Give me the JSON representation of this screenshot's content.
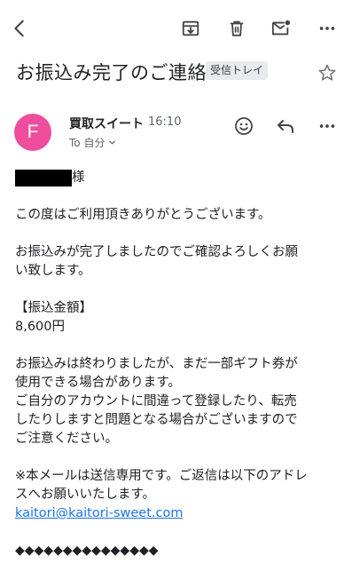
{
  "subject": {
    "title": "お振込み完了のご連絡",
    "label": "受信トレイ"
  },
  "sender": {
    "avatar_letter": "F",
    "avatar_color": "#ef4d9e",
    "name": "買取スイート",
    "time": "16:10",
    "recipient": "To 自分"
  },
  "body": {
    "salutation": "様",
    "lines": [
      "この度はご利用頂きありがとうございます。",
      "お振込みが完了しましたのでご確認よろしくお願",
      "い致します。",
      "【振込金額】",
      "8,600円",
      "お振込みは終わりましたが、まだ一部ギフト券が",
      "使用できる場合があります。",
      "ご自分のアカウントに間違って登録したり、転売",
      "したりしますと問題となる場合がございますので",
      "ご注意ください。",
      "※本メールは送信専用です。ご返信は以下のアドレ",
      "スへお願いいたします。"
    ],
    "email_link": "kaitori@kaitori-sweet.com",
    "separator": "◆◆◆◆◆◆◆◆◆◆◆◆◆◆◆"
  },
  "icons": {
    "toolbar": [
      "back-arrow-icon",
      "archive-icon",
      "trash-icon",
      "mark-unread-icon",
      "more-vert-icon"
    ],
    "subject": [
      "star-icon"
    ],
    "sender": [
      "emoji-react-icon",
      "reply-icon",
      "more-horiz-icon"
    ]
  },
  "colors": {
    "link": "#1a73e8",
    "icon": "#5f6368",
    "chip_bg": "#e8eaed"
  }
}
